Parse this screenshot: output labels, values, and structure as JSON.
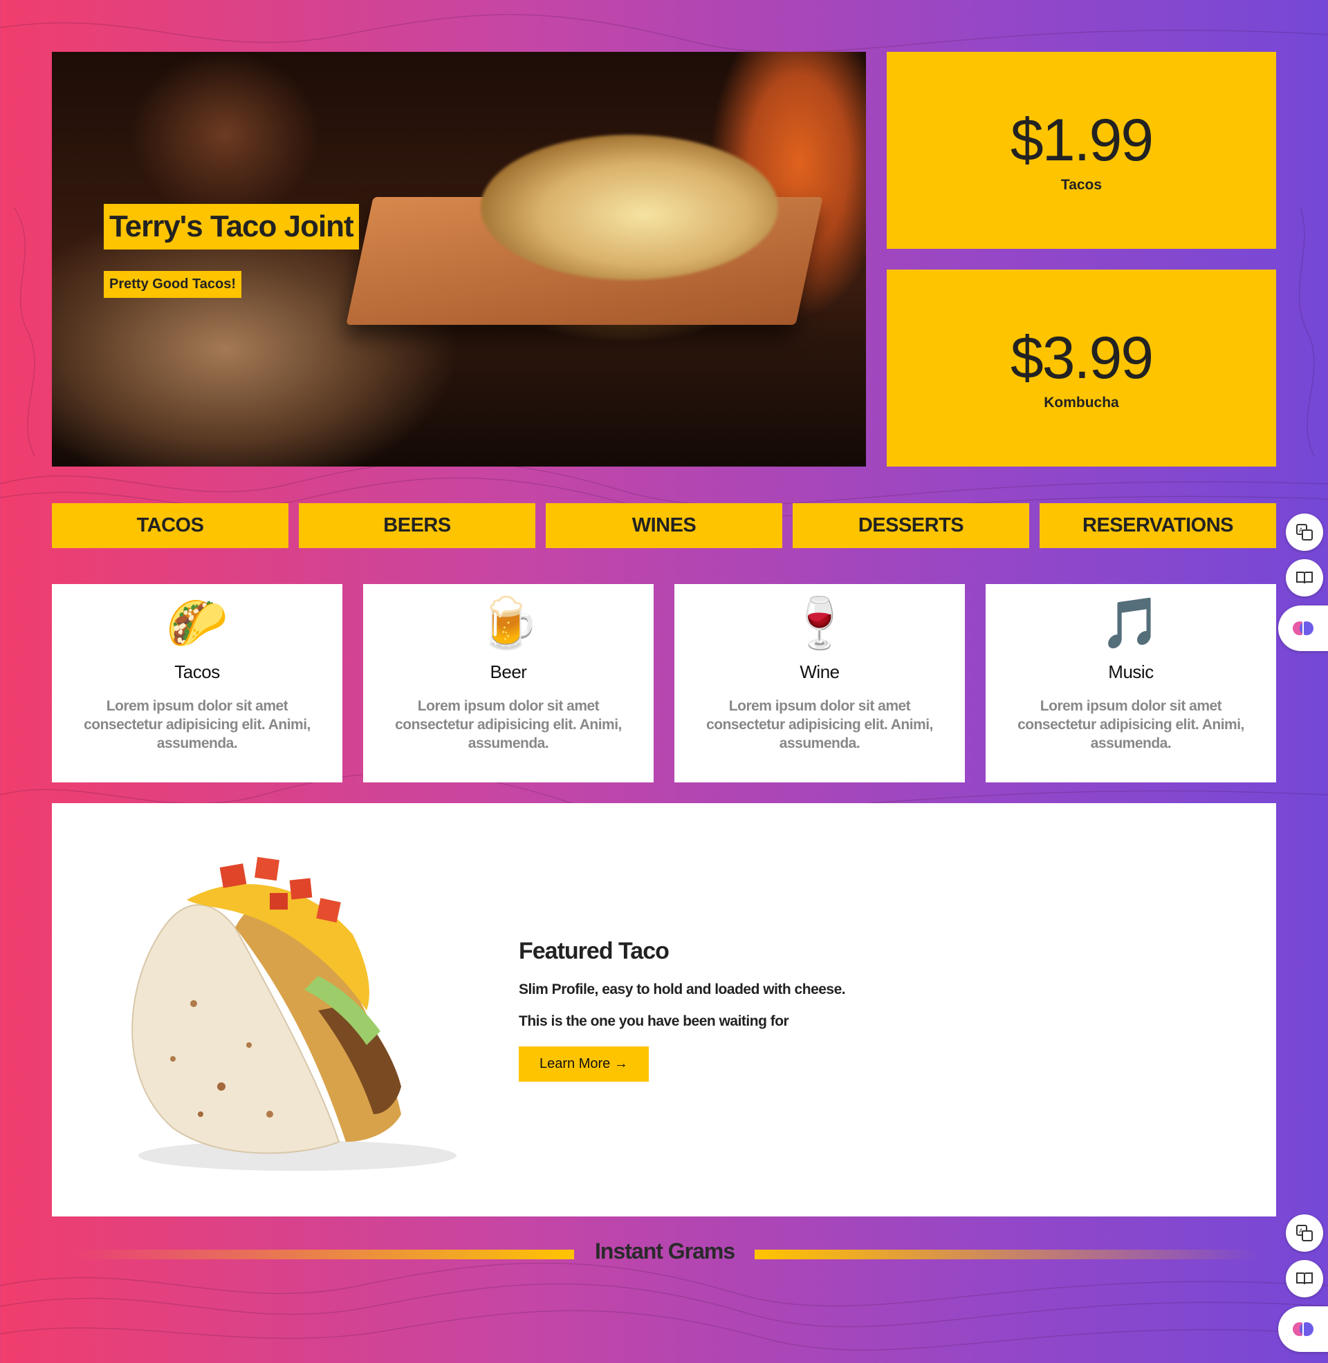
{
  "hero": {
    "title": "Terry's Taco Joint",
    "subtitle": "Pretty Good Tacos!"
  },
  "prices": [
    {
      "amount": "$1.99",
      "label": "Tacos"
    },
    {
      "amount": "$3.99",
      "label": "Kombucha"
    }
  ],
  "nav": [
    "TACOS",
    "BEERS",
    "WINES",
    "DESSERTS",
    "RESERVATIONS"
  ],
  "cards": [
    {
      "emoji": "🌮",
      "icon": "taco-icon",
      "title": "Tacos",
      "text": "Lorem ipsum dolor sit amet consectetur adipisicing elit. Animi, assumenda."
    },
    {
      "emoji": "🍺",
      "icon": "beer-mug-icon",
      "title": "Beer",
      "text": "Lorem ipsum dolor sit amet consectetur adipisicing elit. Animi, assumenda."
    },
    {
      "emoji": "🍷",
      "icon": "wine-glass-icon",
      "title": "Wine",
      "text": "Lorem ipsum dolor sit amet consectetur adipisicing elit. Animi, assumenda."
    },
    {
      "emoji": "🎵",
      "icon": "music-note-icon",
      "title": "Music",
      "text": "Lorem ipsum dolor sit amet consectetur adipisicing elit. Animi, assumenda."
    }
  ],
  "featured": {
    "heading": "Featured Taco",
    "line1": "Slim Profile, easy to hold and loaded with cheese.",
    "line2": "This is the one you have been waiting for",
    "button": "Learn More →"
  },
  "grams": {
    "label": "Instant Grams"
  },
  "colors": {
    "accent": "#ffc400",
    "gradient_start": "#f03e6d",
    "gradient_end": "#7548d6"
  },
  "side_icons": [
    "translate-icon",
    "reader-icon",
    "brain-icon"
  ]
}
